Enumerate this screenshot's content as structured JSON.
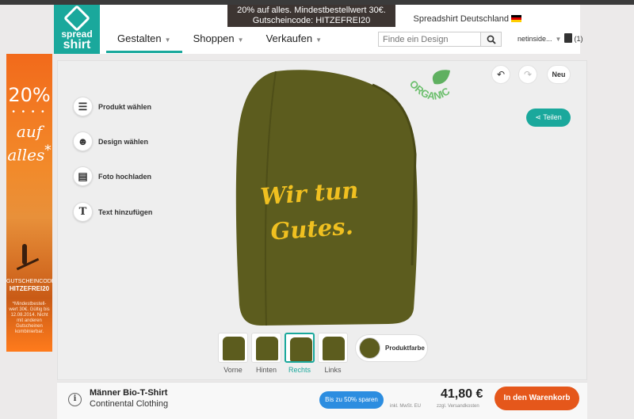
{
  "header": {
    "logo_line1": "spread",
    "logo_line2": "shirt",
    "promo_line1": "20% auf alles. Mindestbestellwert 30€.",
    "promo_line2": "Gutscheincode: HITZEFREI20",
    "country": "Spreadshirt Deutschland",
    "nav": [
      "Gestalten",
      "Shoppen",
      "Verkaufen"
    ],
    "search_placeholder": "Finde ein Design",
    "user": "netinside...",
    "cart_count": "(1)"
  },
  "ad": {
    "percent": "20%",
    "dots": "• • • •",
    "word1": "auf",
    "word2": "alles",
    "star": "*",
    "code_label": "GUTSCHEINCODE:",
    "code": "HITZEFREI20",
    "fine": "*Mindestbestell-wert 30€. Gültig bis 12.08.2014. Nicht mit anderen Gutscheinen kombinierbar.",
    "colors": {
      "primary": "#f26a1b"
    }
  },
  "tools": {
    "product": "Produkt wählen",
    "design": "Design wählen",
    "photo": "Foto hochladen",
    "text": "Text hinzufügen"
  },
  "controls": {
    "new_label": "Neu",
    "share_label": "Teilen",
    "badge_text": "ORGANIC"
  },
  "design_text": {
    "line1": "Wir tun",
    "line2": "Gutes."
  },
  "views": [
    {
      "label": "Vorne",
      "active": false
    },
    {
      "label": "Hinten",
      "active": false
    },
    {
      "label": "Rechts",
      "active": true
    },
    {
      "label": "Links",
      "active": false
    }
  ],
  "color_label": "Produktfarbe",
  "product": {
    "name": "Männer Bio-T-Shirt",
    "brand": "Continental Clothing",
    "save_label": "Bis zu 50% sparen",
    "price": "41,80 €",
    "tax": "inkl. MwSt. EU",
    "shipping": "zzgl. Versandkosten",
    "buy_label": "In den Warenkorb",
    "shirt_color": "#5c5c1e"
  }
}
